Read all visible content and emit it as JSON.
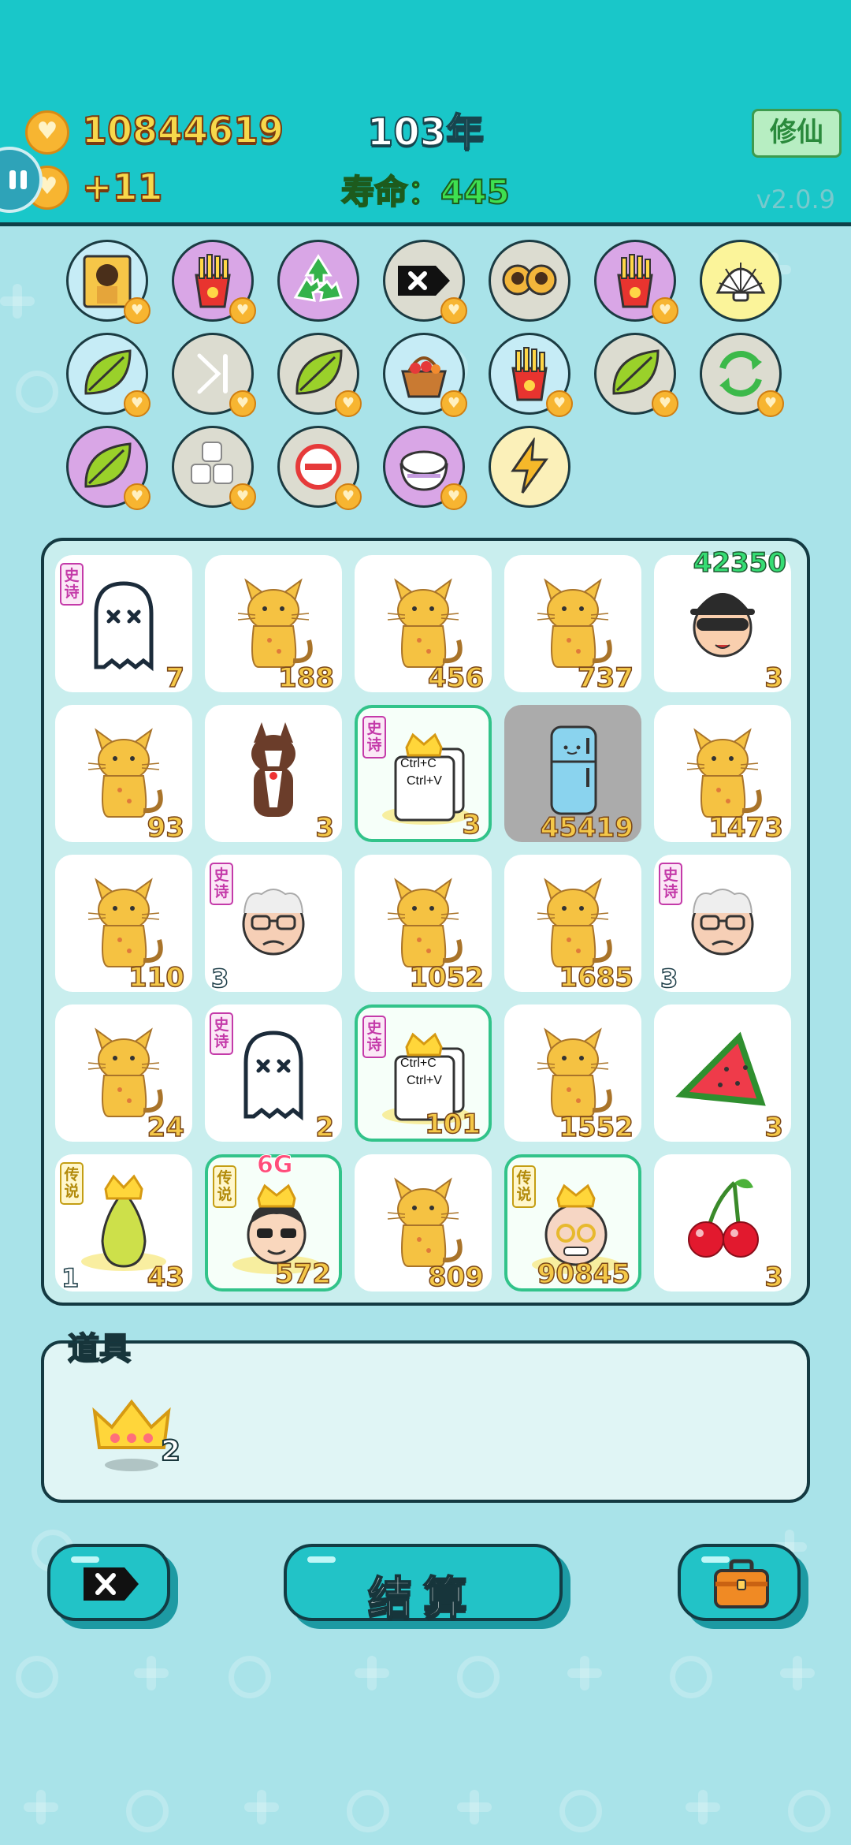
{
  "header": {
    "coins": "10844619",
    "coin_gain": "+11",
    "year": "103年",
    "lifespan": "寿命：445",
    "cultivate_label": "修仙",
    "version": "v2.0.9"
  },
  "skills": [
    {
      "name": "cat-photo",
      "bg": "#c6ecf6",
      "badge": true
    },
    {
      "name": "fries",
      "bg": "#d9a6e6",
      "badge": true
    },
    {
      "name": "recycle",
      "bg": "#d9a6e6",
      "badge": false
    },
    {
      "name": "delete-tag",
      "bg": "#dcdcd0",
      "badge": true
    },
    {
      "name": "cat-pair",
      "bg": "#dcdcd0",
      "badge": false
    },
    {
      "name": "fries",
      "bg": "#d9a6e6",
      "badge": true
    },
    {
      "name": "shell",
      "bg": "#fbf49a",
      "badge": false
    },
    {
      "name": "leaf",
      "bg": "#c6ecf6",
      "badge": true
    },
    {
      "name": "skip",
      "bg": "#dcdcd0",
      "badge": true
    },
    {
      "name": "leaf",
      "bg": "#dcdcd0",
      "badge": true
    },
    {
      "name": "basket",
      "bg": "#c6ecf6",
      "badge": true
    },
    {
      "name": "fries",
      "bg": "#c6ecf6",
      "badge": true
    },
    {
      "name": "leaf",
      "bg": "#dcdcd0",
      "badge": true
    },
    {
      "name": "refresh",
      "bg": "#dcdcd0",
      "badge": true
    },
    {
      "name": "leaf",
      "bg": "#d9a6e6",
      "badge": true
    },
    {
      "name": "blocks",
      "bg": "#dcdcd0",
      "badge": true
    },
    {
      "name": "minus",
      "bg": "#dcdcd0",
      "badge": true
    },
    {
      "name": "rice",
      "bg": "#d9a6e6",
      "badge": true
    },
    {
      "name": "lightning",
      "bg": "#fbf0b9",
      "badge": false
    }
  ],
  "board": {
    "rows": [
      [
        {
          "item": "ghost",
          "count": "7",
          "tag": "史诗"
        },
        {
          "item": "cat",
          "count": "188"
        },
        {
          "item": "cat",
          "count": "456"
        },
        {
          "item": "cat",
          "count": "737"
        },
        {
          "item": "thief",
          "count": "3",
          "top_count": "42350"
        }
      ],
      [
        {
          "item": "cat",
          "count": "93"
        },
        {
          "item": "dog",
          "count": "3"
        },
        {
          "item": "ctrl-cv",
          "count": "3",
          "tag": "史诗",
          "highlight": true,
          "card_line1": "Ctrl+C",
          "card_line2": "Ctrl+V"
        },
        {
          "item": "fridge",
          "count": "45419",
          "grey": true
        },
        {
          "item": "cat",
          "count": "1473"
        }
      ],
      [
        {
          "item": "cat",
          "count": "110"
        },
        {
          "item": "grandpa",
          "left_count": "3",
          "tag": "史诗"
        },
        {
          "item": "cat",
          "count": "1052"
        },
        {
          "item": "cat",
          "count": "1685"
        },
        {
          "item": "grandpa",
          "left_count": "3",
          "tag": "史诗"
        }
      ],
      [
        {
          "item": "cat",
          "count": "24"
        },
        {
          "item": "ghost",
          "count": "2",
          "tag": "史诗"
        },
        {
          "item": "ctrl-cv",
          "count": "101",
          "tag": "史诗",
          "highlight": true,
          "card_line1": "Ctrl+C",
          "card_line2": "Ctrl+V"
        },
        {
          "item": "cat",
          "count": "1552"
        },
        {
          "item": "watermelon",
          "count": "3"
        }
      ],
      [
        {
          "item": "pear-king",
          "count": "43",
          "left_count": "1",
          "tag": "传说"
        },
        {
          "item": "cool-king",
          "count": "572",
          "tag": "传说",
          "highlight": true,
          "label_6g": "6G"
        },
        {
          "item": "cat",
          "count": "809"
        },
        {
          "item": "old-king",
          "count": "90845",
          "tag": "传说",
          "highlight": true
        },
        {
          "item": "cherry",
          "count": "3"
        }
      ]
    ]
  },
  "props": {
    "label": "道具",
    "items": [
      {
        "name": "crown",
        "count": "2"
      }
    ]
  },
  "buttons": {
    "settle_label": "结算"
  }
}
